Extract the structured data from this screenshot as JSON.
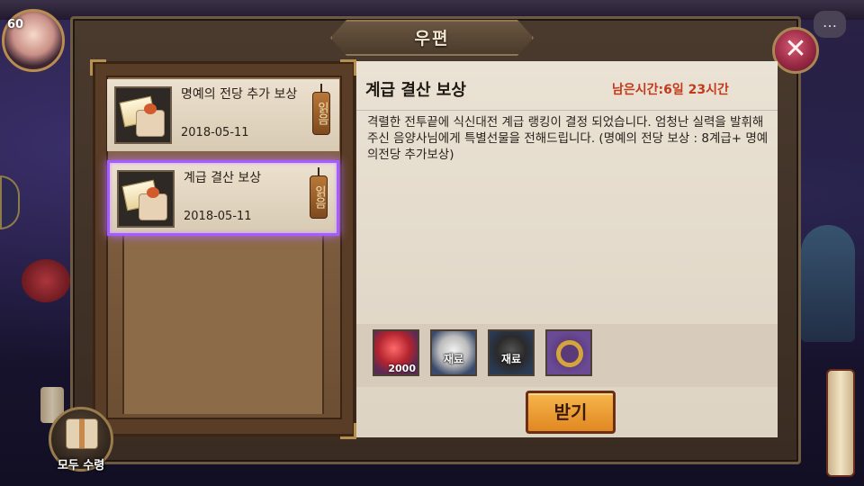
{
  "player": {
    "level": "60"
  },
  "window": {
    "title": "우편",
    "close_symbol": "✕"
  },
  "mail_list": [
    {
      "title": "명예의 전당 추가 보상",
      "date": "2018-05-11",
      "tag": "읽음",
      "selected": false
    },
    {
      "title": "계급 결산 보상",
      "date": "2018-05-11",
      "tag": "읽음",
      "selected": true
    }
  ],
  "detail": {
    "title": "계급 결산 보상",
    "remaining": "남은시간:6일 23시간",
    "body": "격렬한 전투끝에 식신대전 계급 랭킹이 결정 되었습니다. 엄청난 실력을 발휘해주신 음양사님에게 특별선물을 전해드립니다. (명예의 전당 보상 : 8계급+ 명예의전당 추가보상)",
    "rewards": [
      {
        "icon": "red-orb-icon",
        "quantity": "2000",
        "label": ""
      },
      {
        "icon": "white-daruma-icon",
        "quantity": "",
        "label": "재료"
      },
      {
        "icon": "black-daruma-icon",
        "quantity": "",
        "label": "재료"
      },
      {
        "icon": "gold-ring-icon",
        "quantity": "",
        "label": ""
      }
    ],
    "receive_button": "받기"
  },
  "claim_all": {
    "label": "모두 수령"
  },
  "colors": {
    "accent_selected": "#a85cff",
    "remaining_text": "#c23a1a",
    "button_orange": "#f6b64c"
  }
}
